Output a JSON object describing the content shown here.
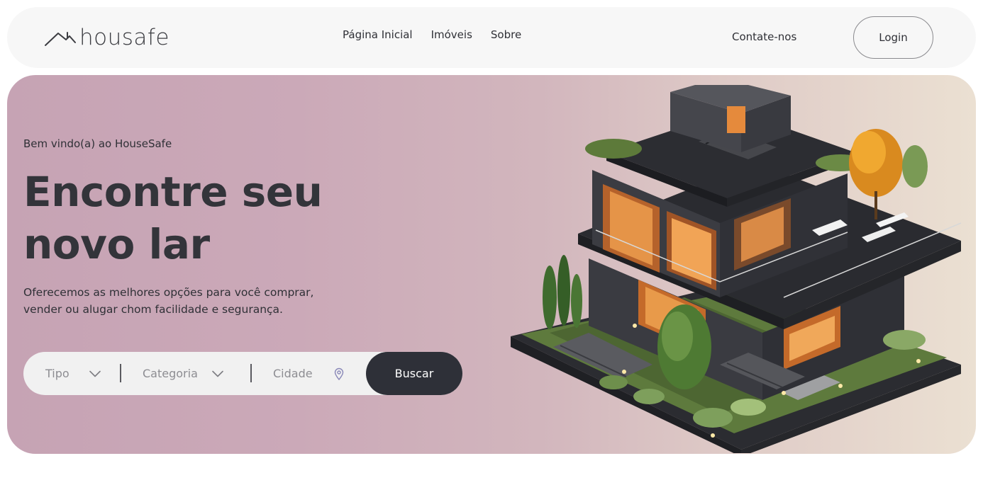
{
  "navbar": {
    "logo_text": "housafe",
    "links": [
      "Página Inicial",
      "Imóveis",
      "Sobre"
    ],
    "contact_label": "Contate-nos",
    "login_label": "Login"
  },
  "hero": {
    "welcome": "Bem vindo(a) ao HouseSafe",
    "headline_line1": "Encontre seu",
    "headline_line2": "novo lar",
    "subtext": "Oferecemos as melhores opções para você comprar, vender ou alugar chom facilidade e segurança.",
    "image_alt": "modern-house-illustration"
  },
  "search": {
    "type_placeholder": "Tipo",
    "category_placeholder": "Categoria",
    "city_placeholder": "Cidade",
    "button_label": "Buscar"
  },
  "colors": {
    "dark": "#2e3038",
    "nav_bg": "#f7f7f7",
    "hero_start": "#c6a3b4",
    "hero_end": "#ebe0d2"
  },
  "icons": [
    "house-roof-logo-icon",
    "chevron-down-icon",
    "map-pin-icon"
  ]
}
